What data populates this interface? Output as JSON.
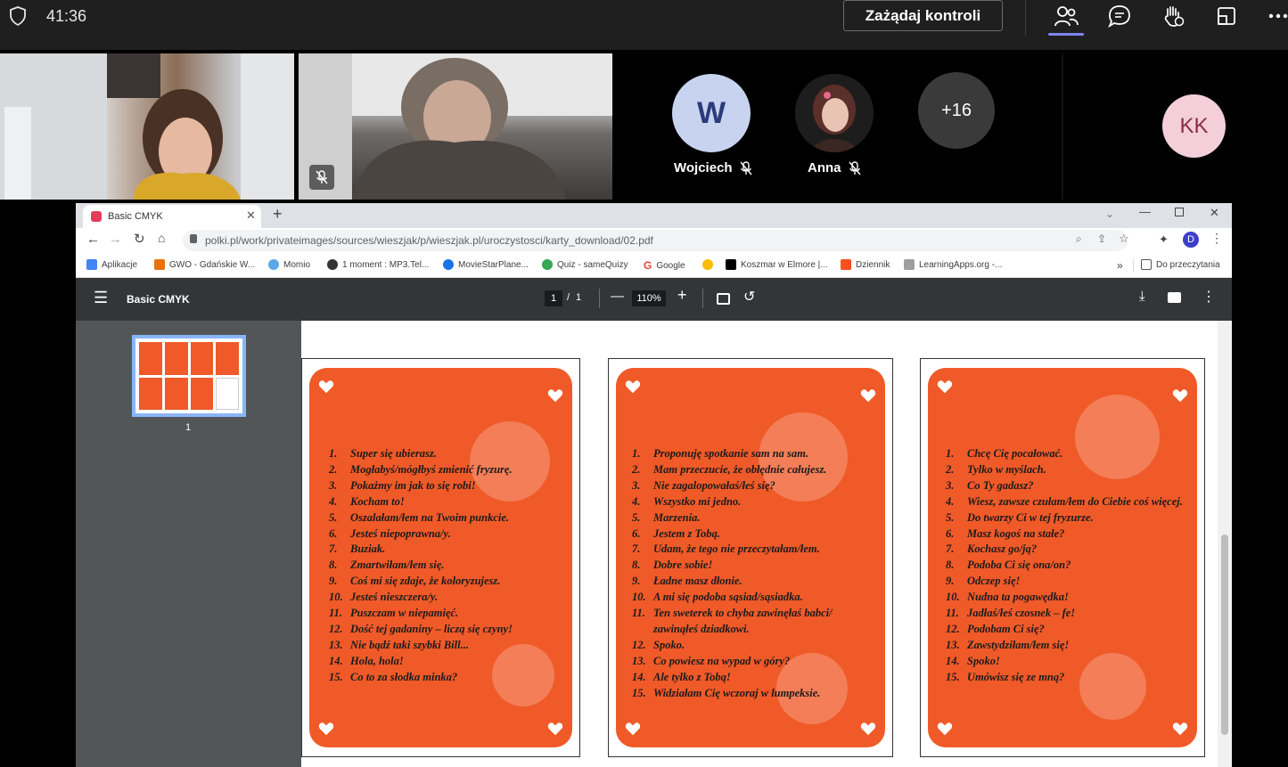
{
  "teams": {
    "timer": "41:36",
    "request_control_label": "Zażądaj kontroli",
    "toolbar_icons": [
      "shield-icon",
      "people-icon",
      "chat-icon",
      "raise-hand-icon",
      "share-icon",
      "more-icon"
    ]
  },
  "participants": {
    "tiles": [
      {
        "initials": "W",
        "name": "Wojciech",
        "muted": true,
        "color": "#c7d3ef"
      },
      {
        "initials": "",
        "name": "Anna",
        "muted": true
      },
      {
        "initials": "+16",
        "name": "",
        "color": "#3a3a3a"
      },
      {
        "initials": "KK",
        "name": "",
        "color": "#f4cfd9"
      }
    ]
  },
  "browser": {
    "tab_title": "Basic CMYK",
    "url": "polki.pl/work/privateimages/sources/wieszjak/p/wieszjak.pl/uroczystosci/karty_download/02.pdf",
    "profile_initial": "D",
    "bookmarks": [
      {
        "label": "Aplikacje",
        "icon": "apps-grid-icon",
        "color": "#4285f4"
      },
      {
        "label": "GWO - Gdańskie W...",
        "icon": "gwo-icon",
        "color": "#e8710a"
      },
      {
        "label": "Momio",
        "icon": "momio-icon",
        "color": "#5aa9e6"
      },
      {
        "label": "1 moment : MP3.Tel...",
        "icon": "mp3-icon",
        "color": "#333333"
      },
      {
        "label": "MovieStarPlane...",
        "icon": "msp-icon",
        "color": "#1a73e8"
      },
      {
        "label": "Quiz - sameQuizy",
        "icon": "quiz-icon",
        "color": "#34a853"
      },
      {
        "label": "Google",
        "icon": "google-icon",
        "color": "#ea4335"
      },
      {
        "label": "",
        "icon": "bookmark-yellow-icon",
        "color": "#fbbc04"
      },
      {
        "label": "Koszmar w Elmore |...",
        "icon": "cn-icon",
        "color": "#000000"
      },
      {
        "label": "Dziennik",
        "icon": "dziennik-icon",
        "color": "#f4511e"
      },
      {
        "label": "LearningApps.org -...",
        "icon": "learningapps-icon",
        "color": "#9e9e9e"
      }
    ],
    "reading_list_label": "Do przeczytania",
    "more_bookmarks": "»"
  },
  "pdf": {
    "title": "Basic CMYK",
    "page_current": "1",
    "page_sep": "/",
    "page_total": "1",
    "zoom": "110%",
    "thumbnail_label": "1"
  },
  "cards": [
    {
      "items": [
        {
          "n": "1.",
          "t": "Super się ubierasz."
        },
        {
          "n": "2.",
          "t": "Mogłabyś/mógłbyś zmienić fryzurę."
        },
        {
          "n": "3.",
          "t": "Pokażmy im jak to się robi!"
        },
        {
          "n": "4.",
          "t": "Kocham to!"
        },
        {
          "n": "5.",
          "t": "Oszalałam/łem na Twoim punkcie."
        },
        {
          "n": "6.",
          "t": "Jesteś niepoprawna/y."
        },
        {
          "n": "7.",
          "t": "Buziak."
        },
        {
          "n": "8.",
          "t": "Zmartwiłam/łem się."
        },
        {
          "n": "9.",
          "t": "Coś mi się zdaje, że koloryzujesz."
        },
        {
          "n": "10.",
          "t": "Jesteś nieszczera/y."
        },
        {
          "n": "11.",
          "t": "Puszczam w niepamięć."
        },
        {
          "n": "12.",
          "t": "Dość tej gadaniny – liczą się czyny!"
        },
        {
          "n": "13.",
          "t": "Nie bądź taki szybki Bill..."
        },
        {
          "n": "14.",
          "t": "Hola, hola!"
        },
        {
          "n": "15.",
          "t": "Co to za słodka minka?"
        }
      ]
    },
    {
      "items": [
        {
          "n": "1.",
          "t": "Proponuję spotkanie sam na sam."
        },
        {
          "n": "2.",
          "t": "Mam przeczucie, że obłędnie całujesz."
        },
        {
          "n": "3.",
          "t": "Nie zagalopowałaś/łeś się?"
        },
        {
          "n": "4.",
          "t": "Wszystko mi jedno."
        },
        {
          "n": "5.",
          "t": "Marzenia."
        },
        {
          "n": "6.",
          "t": "Jestem z Tobą."
        },
        {
          "n": "7.",
          "t": "Udam, że tego nie przeczytałam/łem."
        },
        {
          "n": "8.",
          "t": "Dobre sobie!"
        },
        {
          "n": "9.",
          "t": "Ładne masz dłonie."
        },
        {
          "n": "10.",
          "t": "A mi się podoba sąsiad/sąsiadka."
        },
        {
          "n": "11.",
          "t": "Ten sweterek to chyba zawinęłaś babci/ zawinąłeś dziadkowi."
        },
        {
          "n": "12.",
          "t": "Spoko."
        },
        {
          "n": "13.",
          "t": "Co powiesz na wypad w góry?"
        },
        {
          "n": "14.",
          "t": "Ale tylko z Tobą!"
        },
        {
          "n": "15.",
          "t": "Widziałam Cię wczoraj w lumpeksie."
        }
      ]
    },
    {
      "items": [
        {
          "n": "1.",
          "t": "Chcę Cię pocałować."
        },
        {
          "n": "2.",
          "t": "Tylko w myślach."
        },
        {
          "n": "3.",
          "t": "Co Ty gadasz?"
        },
        {
          "n": "4.",
          "t": "Wiesz, zawsze czułam/łem do Ciebie coś więcej."
        },
        {
          "n": "5.",
          "t": "Do twarzy Ci w tej fryzurze."
        },
        {
          "n": "6.",
          "t": "Masz kogoś na stałe?"
        },
        {
          "n": "7.",
          "t": "Kochasz go/ją?"
        },
        {
          "n": "8.",
          "t": "Podoba Ci się ona/on?"
        },
        {
          "n": "9.",
          "t": "Odczep się!"
        },
        {
          "n": "10.",
          "t": "Nudna ta pogawędka!"
        },
        {
          "n": "11.",
          "t": "Jadłaś/łeś czosnek – fe!"
        },
        {
          "n": "12.",
          "t": "Podobam Ci się?"
        },
        {
          "n": "13.",
          "t": "Zawstydziłam/łem się!"
        },
        {
          "n": "14.",
          "t": "Spoko!"
        },
        {
          "n": "15.",
          "t": "Umówisz się ze mną?"
        }
      ]
    }
  ]
}
